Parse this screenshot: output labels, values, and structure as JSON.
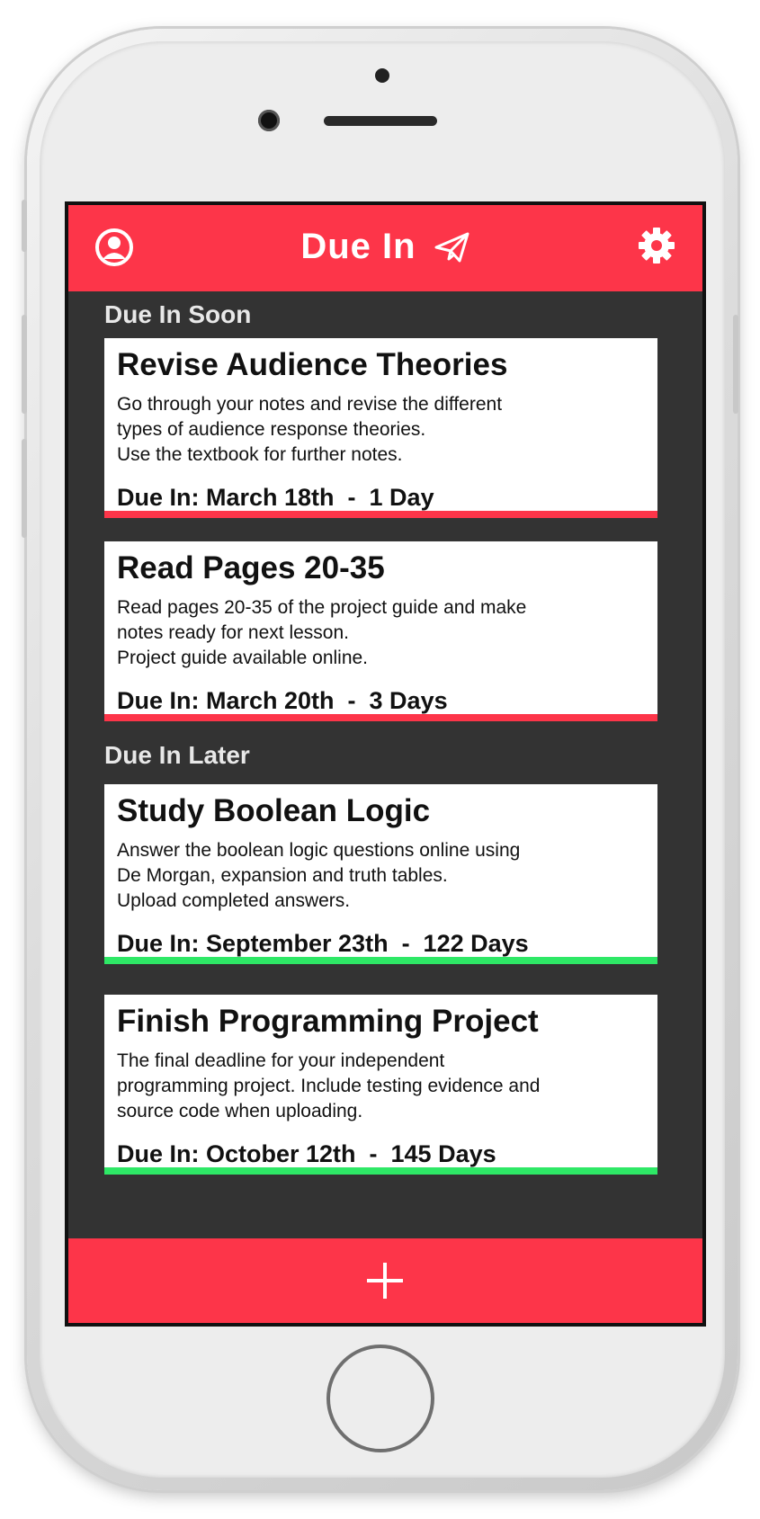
{
  "header": {
    "title": "Due In",
    "profile_icon": "user-circle-icon",
    "settings_icon": "gear-icon",
    "brand_icon": "paper-plane-icon"
  },
  "sections": [
    {
      "heading": "Due In Soon"
    },
    {
      "heading": "Due In Later"
    }
  ],
  "tasks": [
    {
      "title": "Revise Audience Theories",
      "description": [
        "Go through your notes and revise the different",
        "types of audience response theories.",
        "Use the textbook for further notes."
      ],
      "due": "Due In: March 18th  -  1 Day",
      "status_color": "#fd3549"
    },
    {
      "title": "Read Pages 20-35",
      "description": [
        "Read pages 20-35 of the project guide and make",
        "notes ready for next lesson.",
        "Project guide available online."
      ],
      "due": "Due In: March 20th  -  3 Days",
      "status_color": "#fd3549"
    },
    {
      "title": "Study Boolean Logic",
      "description": [
        "Answer the boolean logic questions online using",
        "De Morgan, expansion and truth tables.",
        "Upload completed answers."
      ],
      "due": "Due In: September 23th  -  122 Days",
      "status_color": "#2ee866"
    },
    {
      "title": "Finish Programming Project",
      "description": [
        "The final deadline for your independent",
        "programming project. Include testing evidence and",
        "source code when uploading."
      ],
      "due": "Due In: October 12th  -  145 Days",
      "status_color": "#2ee866"
    }
  ],
  "add_button": {
    "icon": "plus-icon"
  },
  "colors": {
    "accent": "#fd3549",
    "background": "#333333",
    "card": "#ffffff",
    "later": "#2ee866"
  }
}
